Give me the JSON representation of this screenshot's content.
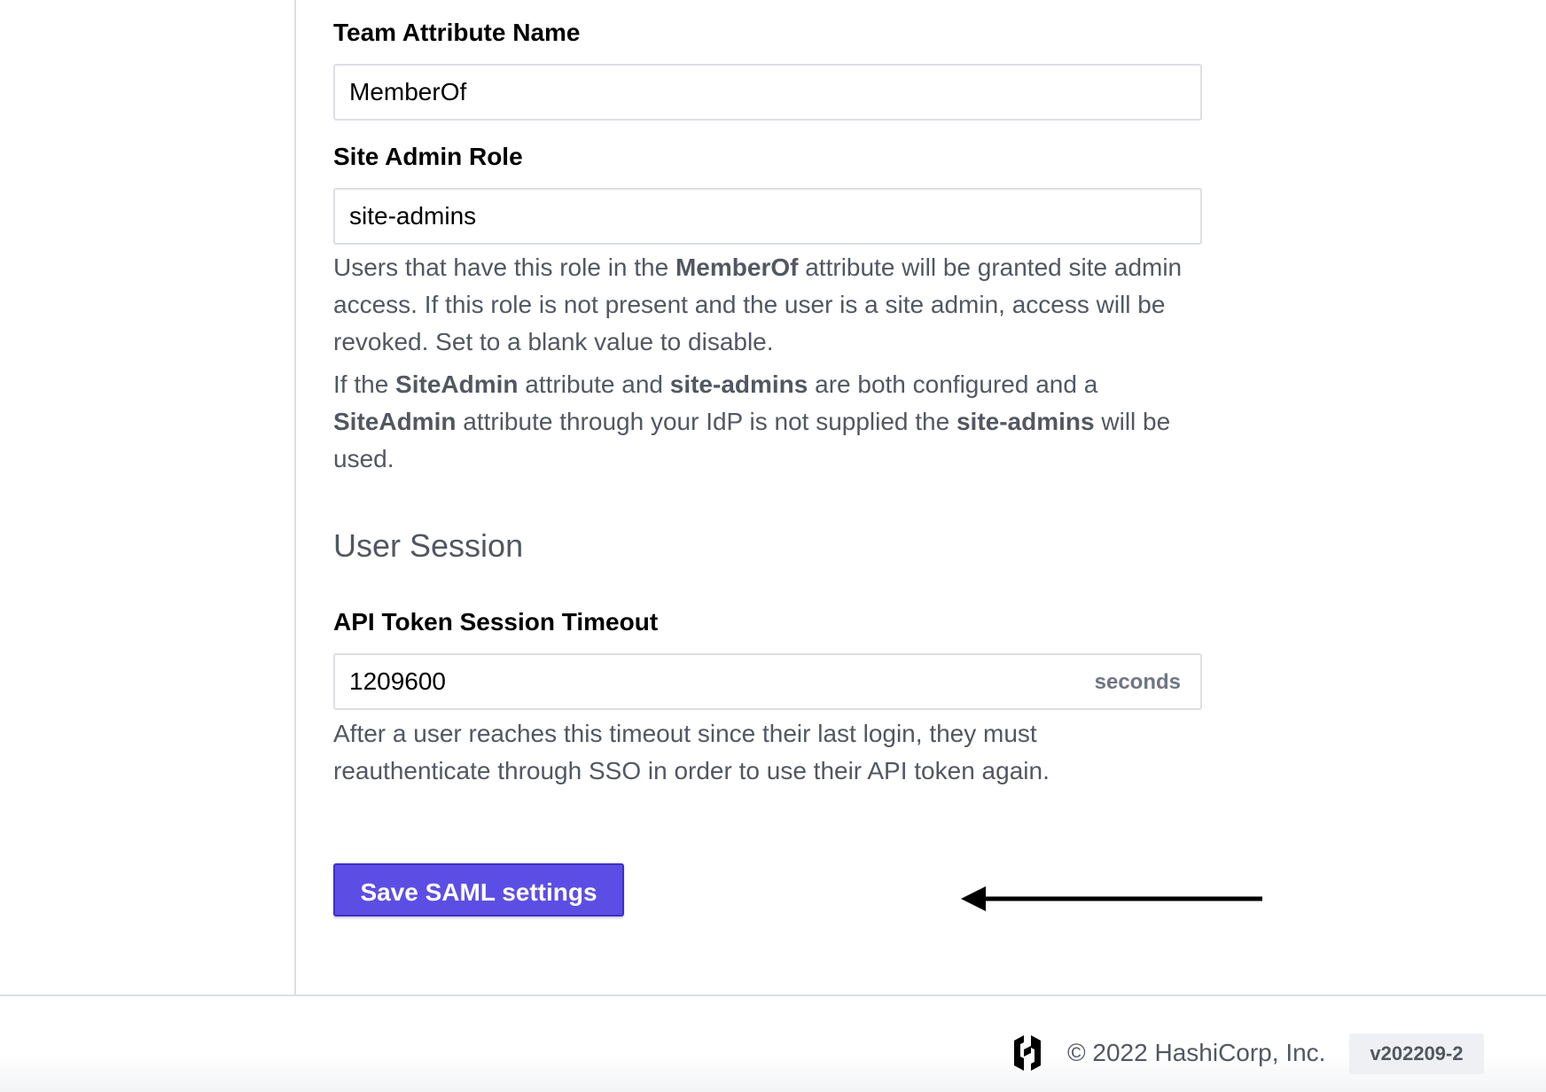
{
  "fields": {
    "team_attribute": {
      "label": "Team Attribute Name",
      "value": "MemberOf"
    },
    "site_admin_role": {
      "label": "Site Admin Role",
      "value": "site-admins",
      "help_1": {
        "pre": "Users that have this role in the ",
        "bold": "MemberOf",
        "post": " attribute will be granted site admin access. If this role is not present and the user is a site admin, access will be revoked. Set to a blank value to disable."
      },
      "help_2": {
        "t1": "If the ",
        "b1": "SiteAdmin",
        "t2": " attribute and ",
        "b2": "site-admins",
        "t3": " are both configured and a ",
        "b3": "SiteAdmin",
        "t4": " attribute through your IdP is not supplied the ",
        "b4": "site-admins",
        "t5": " will be used."
      }
    }
  },
  "user_session": {
    "heading": "User Session",
    "api_token_timeout": {
      "label": "API Token Session Timeout",
      "value": "1209600",
      "suffix": "seconds",
      "help": "After a user reaches this timeout since their last login, they must reauthenticate through SSO in order to use their API token again."
    }
  },
  "actions": {
    "save_label": "Save SAML settings"
  },
  "footer": {
    "logo_icon": "hashicorp-logo-icon",
    "copyright": "© 2022 HashiCorp, Inc.",
    "version": "v202209-2"
  },
  "colors": {
    "primary_button": "#5c4ee5",
    "border": "#dcdfe4",
    "muted_text": "#525761"
  }
}
